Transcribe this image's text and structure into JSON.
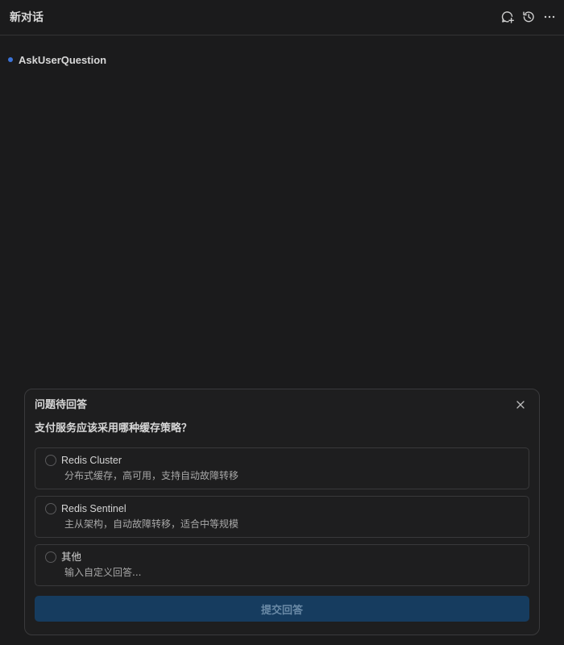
{
  "header": {
    "title": "新对话",
    "actions": [
      {
        "icon": "new-chat-icon"
      },
      {
        "icon": "history-icon"
      },
      {
        "icon": "more-icon"
      }
    ]
  },
  "conversation": {
    "tool_call": {
      "label": "AskUserQuestion",
      "dot_color": "#3b73d8"
    }
  },
  "question_panel": {
    "title": "问题待回答",
    "close_icon": "close-icon",
    "question": "支付服务应该采用哪种缓存策略？",
    "options": [
      {
        "label": "Redis Cluster",
        "description": "分布式缓存，高可用，支持自动故障转移"
      },
      {
        "label": "Redis Sentinel",
        "description": "主从架构，自动故障转移，适合中等规模"
      },
      {
        "label": "其他",
        "description": "输入自定义回答..."
      }
    ],
    "submit_label": "提交回答",
    "submit_color": "#163c5f"
  }
}
